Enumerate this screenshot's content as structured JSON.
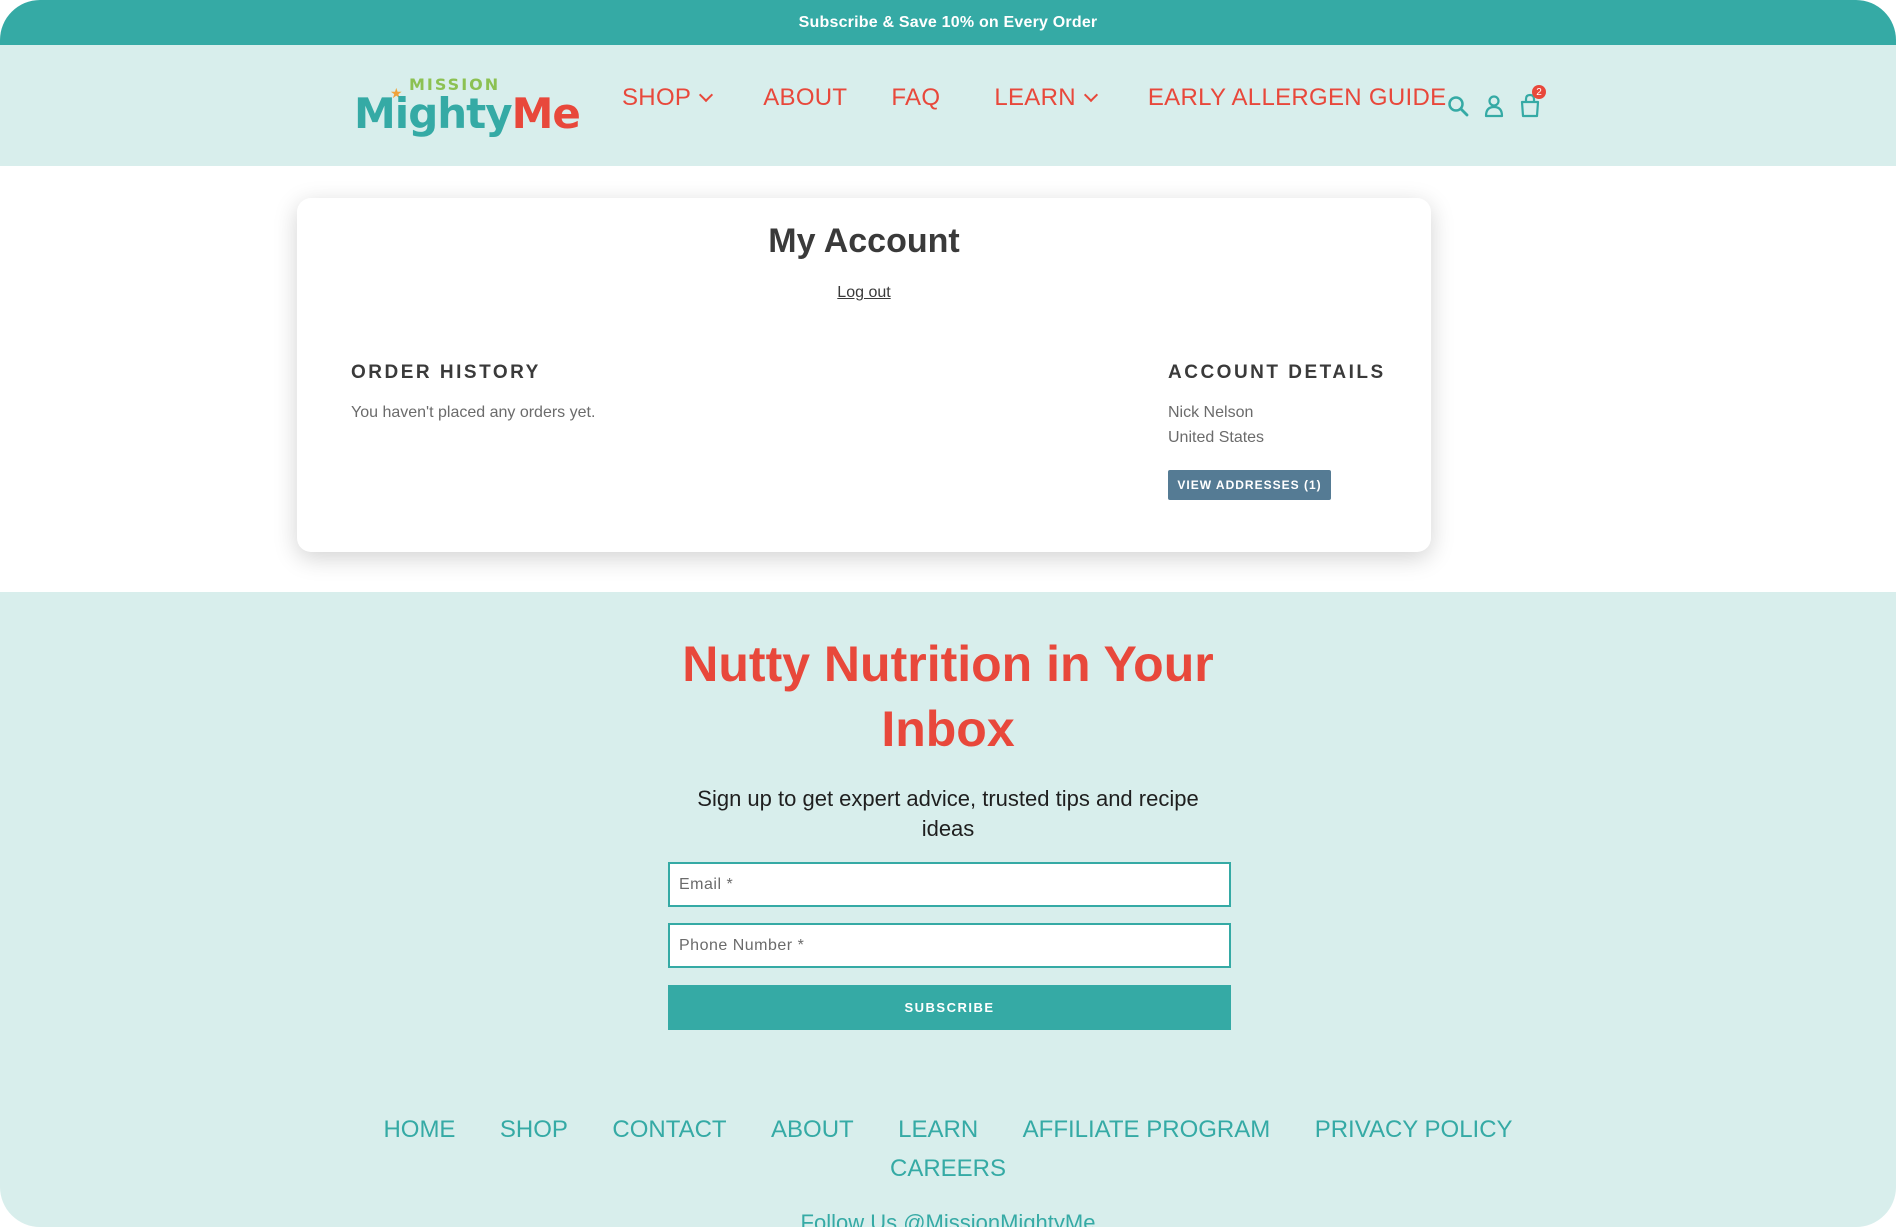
{
  "announcement": "Subscribe & Save 10% on Every Order",
  "logo": {
    "top": "MISSION",
    "main_part1": "Mighty",
    "main_part2": "Me"
  },
  "nav": [
    {
      "label": "SHOP"
    },
    {
      "label": "ABOUT"
    },
    {
      "label": "FAQ"
    },
    {
      "label": "LEARN"
    },
    {
      "label": "EARLY ALLERGEN GUIDE"
    }
  ],
  "cart_count": "2",
  "account": {
    "title": "My Account",
    "logout": "Log out",
    "order_history_heading": "ORDER HISTORY",
    "order_history_text": "You haven't placed any orders yet.",
    "account_details_heading": "ACCOUNT DETAILS",
    "name": "Nick Nelson",
    "country": "United States",
    "view_addresses": "VIEW ADDRESSES (1)"
  },
  "newsletter": {
    "title": "Nutty Nutrition in Your Inbox",
    "subtitle": "Sign up to get expert advice, trusted tips and recipe ideas",
    "email_placeholder": "Email *",
    "phone_placeholder": "Phone Number *",
    "button": "SUBSCRIBE"
  },
  "footer_links": [
    "HOME",
    "SHOP",
    "CONTACT",
    "ABOUT",
    "LEARN",
    "AFFILIATE PROGRAM",
    "PRIVACY POLICY",
    "CAREERS"
  ],
  "follow": "Follow Us @MissionMightyMe",
  "colors": {
    "teal": "#35aaa5",
    "coral": "#e8483b",
    "mint": "#d8eeec",
    "slate": "#557b94"
  }
}
